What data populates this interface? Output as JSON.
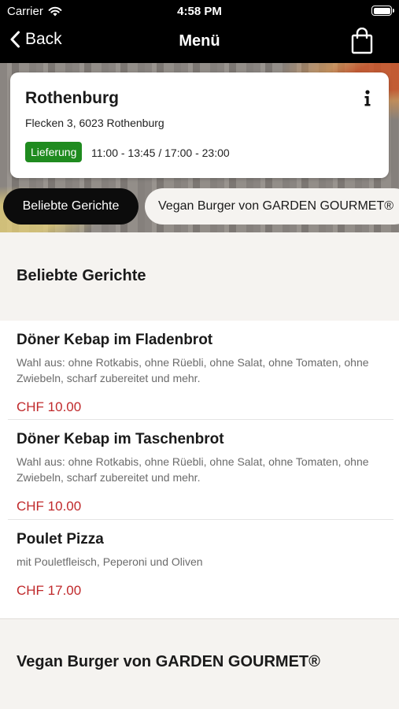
{
  "status_bar": {
    "carrier": "Carrier",
    "time": "4:58 PM",
    "battery_level": 1.0
  },
  "nav": {
    "back_label": "Back",
    "title": "Menü",
    "icons": {
      "back": "chevron-left-icon",
      "cart": "shopping-bag-icon"
    }
  },
  "restaurant": {
    "name": "Rothenburg",
    "address": "Flecken 3, 6023 Rothenburg",
    "delivery_badge": "Lieferung",
    "hours": "11:00 - 13:45 / 17:00 - 23:00",
    "info_icon": "info-icon"
  },
  "categories": [
    "Beliebte Gerichte",
    "Vegan Burger von GARDEN GOURMET®"
  ],
  "active_category": "Beliebte Gerichte",
  "sections": [
    {
      "title": "Beliebte Gerichte",
      "items": [
        {
          "name": "Döner Kebap im Fladenbrot",
          "description": "Wahl aus: ohne Rotkabis, ohne Rüebli, ohne Salat, ohne Tomaten, ohne Zwiebeln, scharf zubereitet und mehr.",
          "price": "CHF 10.00"
        },
        {
          "name": "Döner Kebap im Taschenbrot",
          "description": "Wahl aus: ohne Rotkabis, ohne Rüebli, ohne Salat, ohne Tomaten, ohne Zwiebeln, scharf zubereitet und mehr.",
          "price": "CHF 10.00"
        },
        {
          "name": "Poulet Pizza",
          "description": "mit Pouletfleisch, Peperoni und Oliven",
          "price": "CHF 17.00"
        }
      ]
    },
    {
      "title": "Vegan Burger von GARDEN GOURMET®",
      "items": []
    }
  ],
  "colors": {
    "price": "#c0292b",
    "badge": "#1f8b1f",
    "active_pill": "#0c0c0c",
    "header": "#000000"
  }
}
